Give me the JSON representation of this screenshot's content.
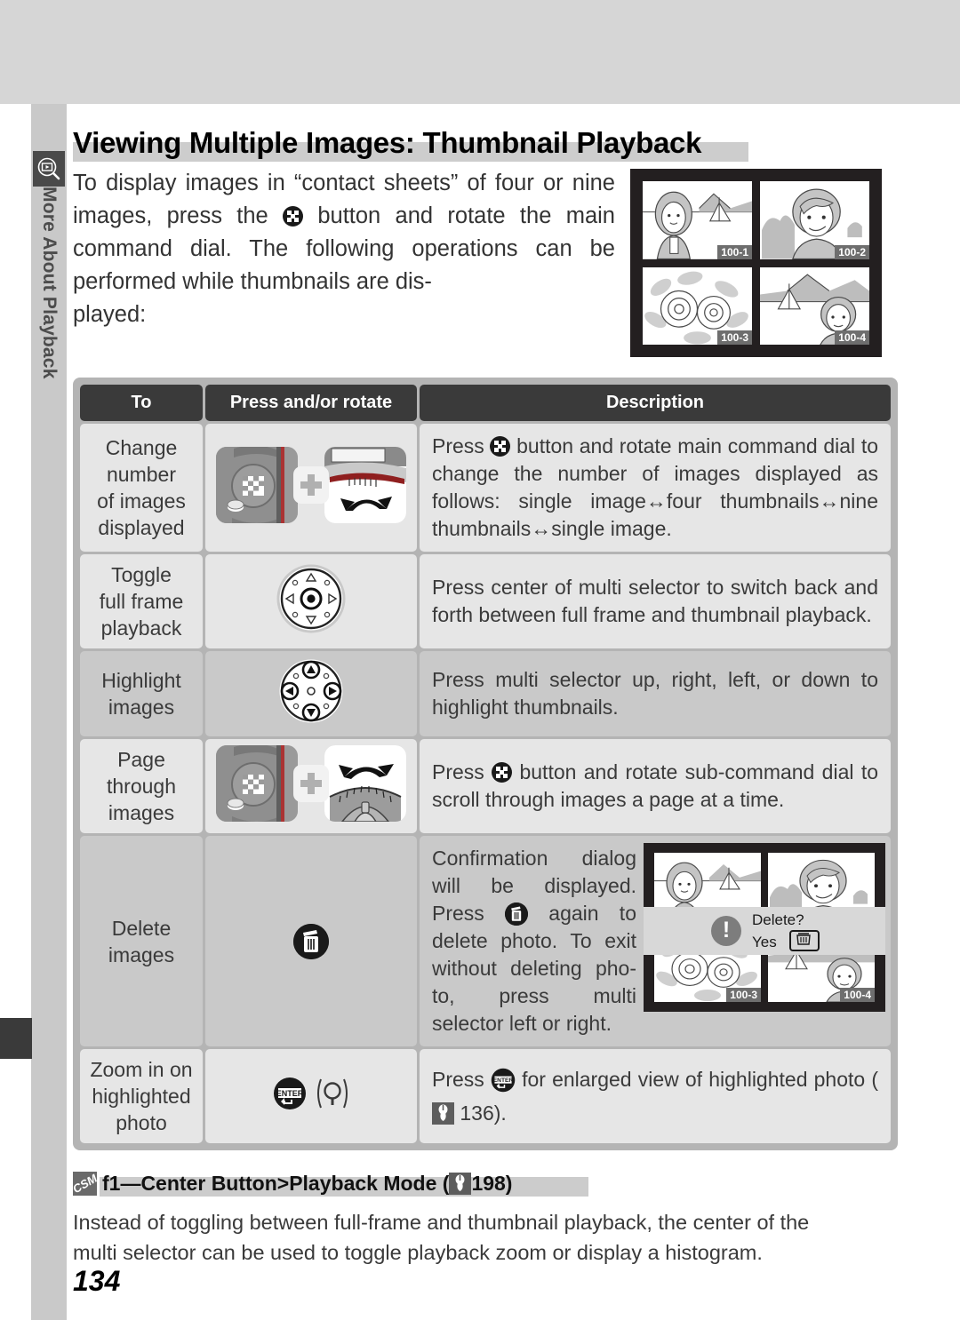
{
  "document": {
    "page_number": "134",
    "side_tab": {
      "label": "More About Playback",
      "icon": "playback-magnifier-icon"
    },
    "heading": "Viewing Multiple Images: Thumbnail Playback",
    "intro_paragraph": "To display images in “contact sheets” of four or nine images, press the ⬛ button and rotate the main command dial.  The following operations can be performed while thumbnails are dis-played:"
  },
  "intro_lines": [
    "To display images in “contact sheets” of four or",
    "nine images, press the",
    "button and rotate the",
    "main command dial.  The following operations",
    "can be performed while thumbnails are dis-",
    "played:"
  ],
  "lcd_figure": {
    "name": "four-thumbnail-playback-screen",
    "thumbnails": [
      {
        "tag": "100-1",
        "subject": "woman-with-sailboat",
        "selected": true
      },
      {
        "tag": "100-2",
        "subject": "child-portrait",
        "selected": false
      },
      {
        "tag": "100-3",
        "subject": "flowers",
        "selected": false
      },
      {
        "tag": "100-4",
        "subject": "boy-with-sailboat",
        "selected": false
      }
    ]
  },
  "table": {
    "headers": [
      "To",
      "Press and/or rotate",
      "Description"
    ],
    "rows": [
      {
        "to": [
          "Change",
          "number",
          "of images",
          "displayed"
        ],
        "control_icons": [
          "thumbnail-button-photo",
          "plus-sign",
          "main-command-dial-photo"
        ],
        "description_parts": [
          "Press ",
          " button and rotate main command dial to change the number of images displayed as follows: single image↔four thumbnails↔nine thumbnails↔single image."
        ],
        "description": "Press ⬛ button and rotate main command dial to change the number of images displayed as follows: single image↔four thumbnails↔nine thumbnails↔single image."
      },
      {
        "to": [
          "Toggle",
          "full frame",
          "playback"
        ],
        "control_icons": [
          "multi-selector-center-press"
        ],
        "description": "Press center of multi selector to switch back and forth between full frame and thumbnail playback."
      },
      {
        "to": [
          "Highlight",
          "images"
        ],
        "control_icons": [
          "multi-selector-directional-press"
        ],
        "description": "Press multi selector up, right, left, or down to highlight thumbnails."
      },
      {
        "to": [
          "Page",
          "through",
          "images"
        ],
        "control_icons": [
          "thumbnail-button-photo",
          "plus-sign",
          "sub-command-dial-photo"
        ],
        "description_parts": [
          "Press ",
          " button and rotate sub-command dial to scroll through images a page at a time."
        ],
        "description": "Press ⬛ button and rotate sub-command dial to scroll through images a page at a time."
      },
      {
        "to": [
          "Delete",
          "images"
        ],
        "control_icons": [
          "delete-trash-button"
        ],
        "description_parts": [
          "Confirmation dialog will be displayed. Press ",
          " again to delete photo.  To exit without deleting pho-to, press multi selector left or right."
        ],
        "description": "Confirmation dialog will be displayed. Press 🗑 again to delete photo. To exit without deleting photo, press multi selector left or right.",
        "figure": {
          "name": "delete-confirmation-screen",
          "dialog_title": "Delete?",
          "dialog_option": "Yes",
          "dialog_icon": "trash-button-icon",
          "thumbnails": [
            {
              "tag": "",
              "subject": "woman-with-sailboat",
              "selected": true
            },
            {
              "tag": "",
              "subject": "child-portrait",
              "selected": false
            },
            {
              "tag": "100-3",
              "subject": "flowers",
              "selected": false
            },
            {
              "tag": "100-4",
              "subject": "boy-with-sailboat",
              "selected": false
            }
          ]
        }
      },
      {
        "to": [
          "Zoom in on",
          "highlighted",
          "photo"
        ],
        "control_icons": [
          "enter-button",
          "magnifier-symbol"
        ],
        "enter_label": "ENTER",
        "magnifier_text": "(  )",
        "description_parts": [
          "Press ",
          " for enlarged view of highlighted photo (",
          " 136)."
        ],
        "description": "Press ENTER for enlarged view of highlighted photo (136).",
        "page_reference": "136"
      }
    ]
  },
  "csm_note": {
    "badge": "CSM",
    "heading": "f1—Center Button>Playback Mode (",
    "heading_ref": "198)",
    "heading_full": "f1—Center Button>Playback Mode ( 198)",
    "body_line1": "Instead of toggling between full-frame and thumbnail playback, the center of the",
    "body_line2": "multi selector can be used to toggle playback zoom or display a histogram.",
    "body": "Instead of toggling between full-frame and thumbnail playback, the center of the multi selector can be used to toggle playback zoom or display a histogram."
  },
  "colors": {
    "top_band": "#d6d6d6",
    "left_strip": "#c9c9c9",
    "tab_mark": "#3a3a3a",
    "table_header": "#3a3a3a",
    "row_light": "#e6e6e6",
    "row_dark": "#c9c9c9",
    "lcd_bezel": "#231f20",
    "text": "#3a3a3a"
  }
}
